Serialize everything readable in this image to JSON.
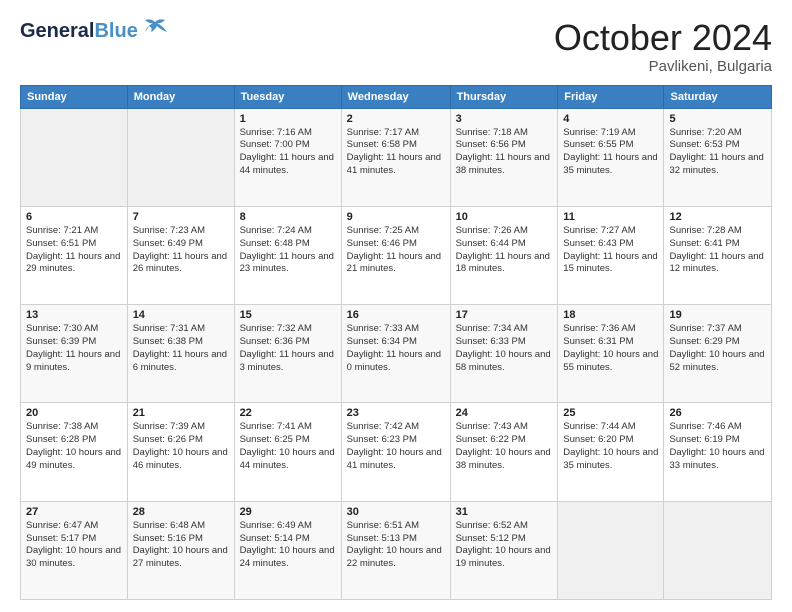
{
  "header": {
    "logo_line1": "General",
    "logo_line2": "Blue",
    "month": "October 2024",
    "location": "Pavlikeni, Bulgaria"
  },
  "weekdays": [
    "Sunday",
    "Monday",
    "Tuesday",
    "Wednesday",
    "Thursday",
    "Friday",
    "Saturday"
  ],
  "weeks": [
    [
      {
        "day": "",
        "info": ""
      },
      {
        "day": "",
        "info": ""
      },
      {
        "day": "1",
        "info": "Sunrise: 7:16 AM\nSunset: 7:00 PM\nDaylight: 11 hours and 44 minutes."
      },
      {
        "day": "2",
        "info": "Sunrise: 7:17 AM\nSunset: 6:58 PM\nDaylight: 11 hours and 41 minutes."
      },
      {
        "day": "3",
        "info": "Sunrise: 7:18 AM\nSunset: 6:56 PM\nDaylight: 11 hours and 38 minutes."
      },
      {
        "day": "4",
        "info": "Sunrise: 7:19 AM\nSunset: 6:55 PM\nDaylight: 11 hours and 35 minutes."
      },
      {
        "day": "5",
        "info": "Sunrise: 7:20 AM\nSunset: 6:53 PM\nDaylight: 11 hours and 32 minutes."
      }
    ],
    [
      {
        "day": "6",
        "info": "Sunrise: 7:21 AM\nSunset: 6:51 PM\nDaylight: 11 hours and 29 minutes."
      },
      {
        "day": "7",
        "info": "Sunrise: 7:23 AM\nSunset: 6:49 PM\nDaylight: 11 hours and 26 minutes."
      },
      {
        "day": "8",
        "info": "Sunrise: 7:24 AM\nSunset: 6:48 PM\nDaylight: 11 hours and 23 minutes."
      },
      {
        "day": "9",
        "info": "Sunrise: 7:25 AM\nSunset: 6:46 PM\nDaylight: 11 hours and 21 minutes."
      },
      {
        "day": "10",
        "info": "Sunrise: 7:26 AM\nSunset: 6:44 PM\nDaylight: 11 hours and 18 minutes."
      },
      {
        "day": "11",
        "info": "Sunrise: 7:27 AM\nSunset: 6:43 PM\nDaylight: 11 hours and 15 minutes."
      },
      {
        "day": "12",
        "info": "Sunrise: 7:28 AM\nSunset: 6:41 PM\nDaylight: 11 hours and 12 minutes."
      }
    ],
    [
      {
        "day": "13",
        "info": "Sunrise: 7:30 AM\nSunset: 6:39 PM\nDaylight: 11 hours and 9 minutes."
      },
      {
        "day": "14",
        "info": "Sunrise: 7:31 AM\nSunset: 6:38 PM\nDaylight: 11 hours and 6 minutes."
      },
      {
        "day": "15",
        "info": "Sunrise: 7:32 AM\nSunset: 6:36 PM\nDaylight: 11 hours and 3 minutes."
      },
      {
        "day": "16",
        "info": "Sunrise: 7:33 AM\nSunset: 6:34 PM\nDaylight: 11 hours and 0 minutes."
      },
      {
        "day": "17",
        "info": "Sunrise: 7:34 AM\nSunset: 6:33 PM\nDaylight: 10 hours and 58 minutes."
      },
      {
        "day": "18",
        "info": "Sunrise: 7:36 AM\nSunset: 6:31 PM\nDaylight: 10 hours and 55 minutes."
      },
      {
        "day": "19",
        "info": "Sunrise: 7:37 AM\nSunset: 6:29 PM\nDaylight: 10 hours and 52 minutes."
      }
    ],
    [
      {
        "day": "20",
        "info": "Sunrise: 7:38 AM\nSunset: 6:28 PM\nDaylight: 10 hours and 49 minutes."
      },
      {
        "day": "21",
        "info": "Sunrise: 7:39 AM\nSunset: 6:26 PM\nDaylight: 10 hours and 46 minutes."
      },
      {
        "day": "22",
        "info": "Sunrise: 7:41 AM\nSunset: 6:25 PM\nDaylight: 10 hours and 44 minutes."
      },
      {
        "day": "23",
        "info": "Sunrise: 7:42 AM\nSunset: 6:23 PM\nDaylight: 10 hours and 41 minutes."
      },
      {
        "day": "24",
        "info": "Sunrise: 7:43 AM\nSunset: 6:22 PM\nDaylight: 10 hours and 38 minutes."
      },
      {
        "day": "25",
        "info": "Sunrise: 7:44 AM\nSunset: 6:20 PM\nDaylight: 10 hours and 35 minutes."
      },
      {
        "day": "26",
        "info": "Sunrise: 7:46 AM\nSunset: 6:19 PM\nDaylight: 10 hours and 33 minutes."
      }
    ],
    [
      {
        "day": "27",
        "info": "Sunrise: 6:47 AM\nSunset: 5:17 PM\nDaylight: 10 hours and 30 minutes."
      },
      {
        "day": "28",
        "info": "Sunrise: 6:48 AM\nSunset: 5:16 PM\nDaylight: 10 hours and 27 minutes."
      },
      {
        "day": "29",
        "info": "Sunrise: 6:49 AM\nSunset: 5:14 PM\nDaylight: 10 hours and 24 minutes."
      },
      {
        "day": "30",
        "info": "Sunrise: 6:51 AM\nSunset: 5:13 PM\nDaylight: 10 hours and 22 minutes."
      },
      {
        "day": "31",
        "info": "Sunrise: 6:52 AM\nSunset: 5:12 PM\nDaylight: 10 hours and 19 minutes."
      },
      {
        "day": "",
        "info": ""
      },
      {
        "day": "",
        "info": ""
      }
    ]
  ]
}
